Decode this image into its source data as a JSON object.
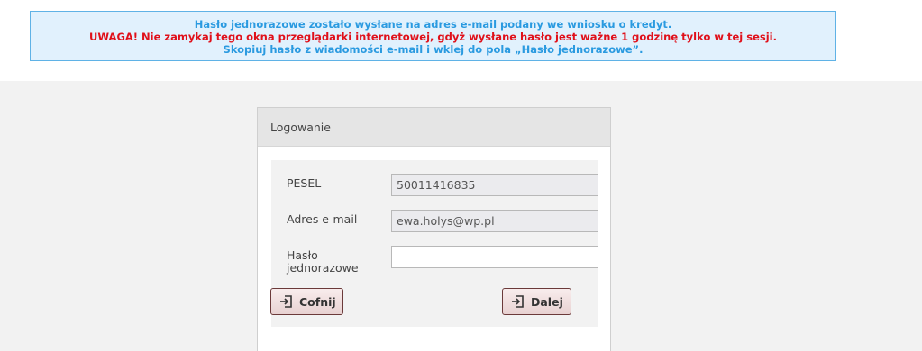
{
  "notice": {
    "line1": "Hasło jednorazowe zostało wysłane na adres e-mail podany we wniosku o kredyt.",
    "line2": "UWAGA! Nie zamykaj tego okna przeglądarki internetowej, gdyż wysłane hasło jest ważne 1 godzinę tylko w tej sesji.",
    "line3": "Skopiuj hasło z wiadomości e-mail i wklej do pola „Hasło jednorazowe”."
  },
  "panel": {
    "title": "Logowanie"
  },
  "form": {
    "pesel_label": "PESEL",
    "pesel_value": "50011416835",
    "email_label": "Adres e-mail",
    "email_value": "ewa.holys@wp.pl",
    "otp_label_line1": "Hasło",
    "otp_label_line2": "jednorazowe",
    "otp_value": ""
  },
  "buttons": {
    "back_label": "Cofnij",
    "back_icon": "sign-in-icon",
    "next_label": "Dalej",
    "next_icon": "sign-in-icon"
  },
  "colors": {
    "notice_blue": "#2a9ae0",
    "notice_red": "#e0101a",
    "notice_bg": "#e1f1fd",
    "button_border": "#6b3a3a"
  }
}
